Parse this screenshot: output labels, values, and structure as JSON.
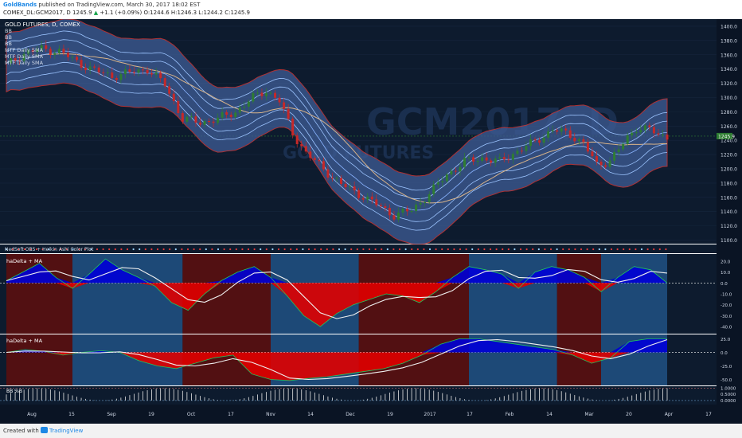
{
  "header": {
    "brand": "GoldBands",
    "published": " published on TradingView.com, March 30, 2017 18:02 EST",
    "symbol": "COMEX_DL:GCM2017, D",
    "last": "1245.9",
    "change_arrow": "▲",
    "change": "+1.1 (+0.09%)",
    "ohlc": "O:1244.6  H:1246.3  L:1244.2  C:1245.9"
  },
  "main_legend": {
    "title": "GOLD FUTURES, D, COMEX",
    "items": [
      "BB",
      "BB",
      "BB",
      "MTF Daily SMA",
      "MTF Daily SMA",
      "MTF Daily SMA"
    ]
  },
  "watermark": {
    "line1": "GCM2017, D",
    "line2": "GOLD FUTURES"
  },
  "subpanes": {
    "plot_label": "NedSoft OBS + Heikin Ashi Color Plot",
    "pane1_label": "haDelta + MA",
    "pane2_label": "haDelta + MA",
    "pane3_label": "BB %B"
  },
  "footer": {
    "created": "Created with",
    "brand": "TradingView"
  },
  "colors": {
    "band_fill": "#3f5d96",
    "band_outer": "#e53935",
    "sma_fast": "#8ab4ff",
    "sma_slow": "#d9b48a",
    "bull": "#2e7d32",
    "bear": "#c62828",
    "regime_bull": "#1f4f80",
    "regime_bear": "#5a1010",
    "ha_up": "#0000d6",
    "ha_down": "#e00000"
  },
  "chart_data": [
    {
      "type": "candlestick",
      "title": "GOLD FUTURES, D, COMEX",
      "y_axis": {
        "ylim": [
          1095,
          1410
        ],
        "ticks": [
          1100,
          1120,
          1140,
          1160,
          1180,
          1200,
          1220,
          1240,
          1260,
          1280,
          1300,
          1320,
          1340,
          1360,
          1380,
          1400
        ],
        "last_price_label": "1245.9"
      },
      "x_axis": {
        "ticks": [
          "Aug",
          "15",
          "Sep",
          "19",
          "Oct",
          "17",
          "Nov",
          "14",
          "Dec",
          "19",
          "2017",
          "17",
          "Feb",
          "14",
          "Mar",
          "20",
          "Apr",
          "17"
        ]
      },
      "close_path": [
        {
          "x": 0,
          "y": 1345
        },
        {
          "x": 8,
          "y": 1362
        },
        {
          "x": 16,
          "y": 1368
        },
        {
          "x": 24,
          "y": 1365
        },
        {
          "x": 32,
          "y": 1350
        },
        {
          "x": 40,
          "y": 1338
        },
        {
          "x": 48,
          "y": 1330
        },
        {
          "x": 56,
          "y": 1335
        },
        {
          "x": 64,
          "y": 1340
        },
        {
          "x": 72,
          "y": 1318
        },
        {
          "x": 80,
          "y": 1270
        },
        {
          "x": 88,
          "y": 1265
        },
        {
          "x": 96,
          "y": 1270
        },
        {
          "x": 104,
          "y": 1280
        },
        {
          "x": 112,
          "y": 1300
        },
        {
          "x": 118,
          "y": 1310
        },
        {
          "x": 124,
          "y": 1295
        },
        {
          "x": 130,
          "y": 1250
        },
        {
          "x": 136,
          "y": 1222
        },
        {
          "x": 144,
          "y": 1200
        },
        {
          "x": 152,
          "y": 1178
        },
        {
          "x": 160,
          "y": 1165
        },
        {
          "x": 168,
          "y": 1150
        },
        {
          "x": 176,
          "y": 1135
        },
        {
          "x": 184,
          "y": 1142
        },
        {
          "x": 192,
          "y": 1165
        },
        {
          "x": 200,
          "y": 1192
        },
        {
          "x": 208,
          "y": 1210
        },
        {
          "x": 216,
          "y": 1215
        },
        {
          "x": 224,
          "y": 1210
        },
        {
          "x": 232,
          "y": 1225
        },
        {
          "x": 240,
          "y": 1238
        },
        {
          "x": 248,
          "y": 1255
        },
        {
          "x": 256,
          "y": 1248
        },
        {
          "x": 262,
          "y": 1236
        },
        {
          "x": 268,
          "y": 1205
        },
        {
          "x": 274,
          "y": 1212
        },
        {
          "x": 280,
          "y": 1235
        },
        {
          "x": 286,
          "y": 1258
        },
        {
          "x": 292,
          "y": 1256
        },
        {
          "x": 296,
          "y": 1246
        }
      ],
      "bollinger_bands": "3 bands around price; outer band (red edge) spans roughly 1115–1405",
      "sma_lines": "3 MTF daily SMAs (light blue, light blue, tan)"
    },
    {
      "type": "heatmap",
      "title": "NedSoft OBS + Heikin Ashi Color Plot",
      "note": "row of colored dots + bull/bear regime shading spanning the lower panes"
    },
    {
      "type": "area",
      "title": "haDelta + MA",
      "ylim": [
        -45,
        25
      ],
      "y_ticks": [
        20,
        10,
        0,
        -10,
        -20,
        -30,
        -40
      ],
      "series": [
        {
          "values": [
            2,
            10,
            18,
            5,
            -5,
            8,
            22,
            12,
            5,
            -3,
            -18,
            -25,
            -10,
            2,
            10,
            15,
            5,
            -12,
            -30,
            -40,
            -28,
            -20,
            -15,
            -10,
            -12,
            -18,
            -8,
            5,
            15,
            12,
            8,
            -5,
            10,
            15,
            12,
            5,
            -8,
            5,
            15,
            12,
            0
          ]
        }
      ]
    },
    {
      "type": "area",
      "title": "haDelta + MA",
      "ylim": [
        -58,
        30
      ],
      "y_ticks": [
        25,
        0,
        -25,
        -50
      ],
      "series": [
        {
          "values": [
            0,
            5,
            2,
            -5,
            0,
            3,
            0,
            -15,
            -25,
            -30,
            -20,
            -10,
            -5,
            -40,
            -50,
            -52,
            -48,
            -45,
            -40,
            -35,
            -30,
            -20,
            -5,
            15,
            25,
            25,
            20,
            15,
            10,
            5,
            -5,
            -20,
            -10,
            20,
            25,
            25
          ]
        }
      ]
    },
    {
      "type": "bar",
      "title": "BB %B",
      "ylim": [
        -0.2,
        1.1
      ],
      "y_ticks": [
        1.0,
        0.5,
        0.0
      ]
    }
  ]
}
